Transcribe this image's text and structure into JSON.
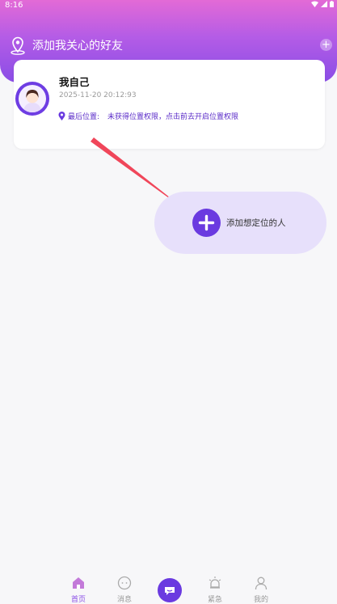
{
  "status_bar": {
    "time": "8:16"
  },
  "header": {
    "title": "添加我关心的好友",
    "add_icon": "plus-icon"
  },
  "self_card": {
    "name": "我自己",
    "date": "2025-11-20 20:12:93",
    "location_label": "最后位置:",
    "location_value": "未获得位置权限，点击前去开启位置权限"
  },
  "add_person": {
    "label": "添加想定位的人"
  },
  "tabs": [
    {
      "label": "首页",
      "icon": "home-icon",
      "active": true
    },
    {
      "label": "消息",
      "icon": "message-icon",
      "active": false
    },
    {
      "label": "",
      "icon": "center-chat-icon",
      "active": false
    },
    {
      "label": "紧急",
      "icon": "alarm-icon",
      "active": false
    },
    {
      "label": "我的",
      "icon": "user-icon",
      "active": false
    }
  ],
  "colors": {
    "accent": "#6a3ae0",
    "header_top": "#e36ad6",
    "header_bottom": "#8a4de6",
    "arrow": "#f0465a"
  }
}
